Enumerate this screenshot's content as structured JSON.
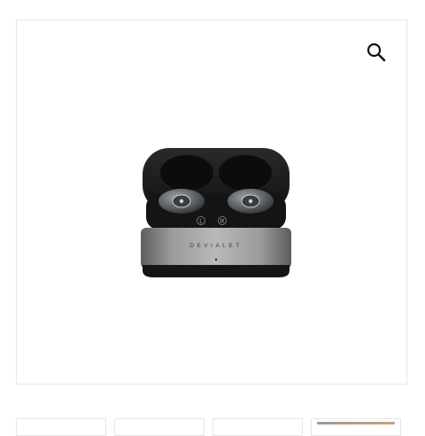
{
  "product": {
    "brand_mark": "DEVIALET",
    "earbud_labels": [
      "L",
      "R"
    ]
  },
  "gallery": {
    "zoom_icon": "magnifier-icon",
    "thumbnail_count": 4,
    "active_thumbnail": 4
  },
  "colors": {
    "border": "#e6e6e6",
    "icon": "#111111",
    "case_metal": "#8a8a8a",
    "case_dark": "#1e1e1e",
    "active_thumb_accent": "#c9a27a"
  }
}
